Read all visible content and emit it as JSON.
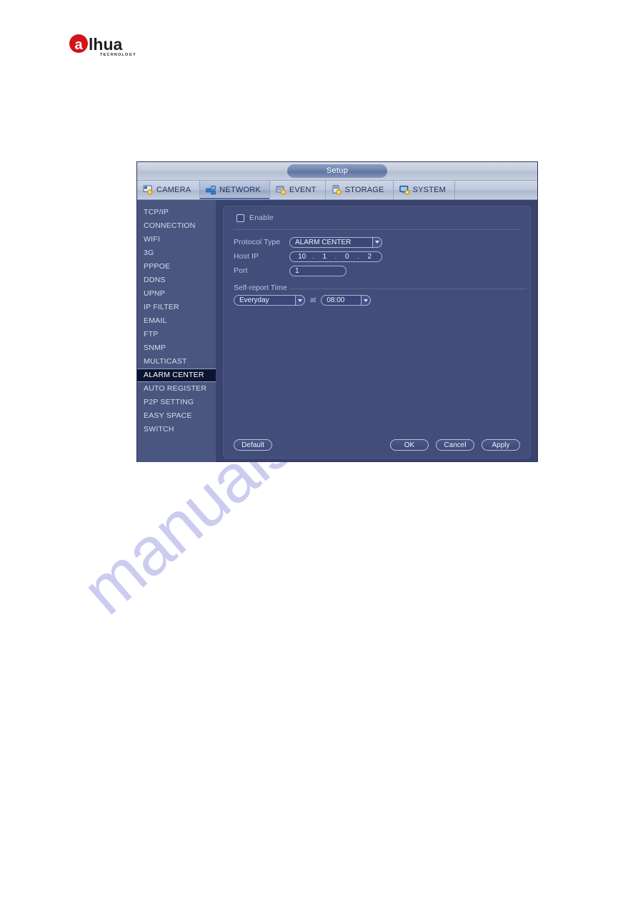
{
  "brand": {
    "logo_mark": "a",
    "logo_text": "lhua",
    "logo_sub": "TECHNOLOGY",
    "logo_red": "#d3121a",
    "logo_dark": "#231f20"
  },
  "watermark": {
    "text": "manualshive.com"
  },
  "dialog": {
    "title": "Setup",
    "tabs": [
      {
        "label": "CAMERA",
        "icon": "camera-gear-icon",
        "active": false
      },
      {
        "label": "NETWORK",
        "icon": "network-icon",
        "active": true
      },
      {
        "label": "EVENT",
        "icon": "event-gear-icon",
        "active": false
      },
      {
        "label": "STORAGE",
        "icon": "storage-gear-icon",
        "active": false
      },
      {
        "label": "SYSTEM",
        "icon": "system-gear-icon",
        "active": false
      }
    ],
    "sidebar": {
      "selected": "ALARM CENTER",
      "items": [
        "TCP/IP",
        "CONNECTION",
        "WIFI",
        "3G",
        "PPPOE",
        "DDNS",
        "UPNP",
        "IP FILTER",
        "EMAIL",
        "FTP",
        "SNMP",
        "MULTICAST",
        "ALARM CENTER",
        "AUTO REGISTER",
        "P2P SETTING",
        "EASY SPACE",
        "SWITCH"
      ]
    },
    "form": {
      "enable_label": "Enable",
      "enable_checked": false,
      "protocol_type_label": "Protocol Type",
      "protocol_type_value": "ALARM CENTER",
      "host_ip_label": "Host IP",
      "host_ip_octets": [
        "10",
        "1",
        "0",
        "2"
      ],
      "ip_separator": ".",
      "port_label": "Port",
      "port_value": "1",
      "self_report_label": "Self-report Time",
      "schedule_day_value": "Everyday",
      "at_label": "at",
      "schedule_time_value": "08:00"
    },
    "buttons": {
      "default_label": "Default",
      "ok_label": "OK",
      "cancel_label": "Cancel",
      "apply_label": "Apply"
    }
  }
}
